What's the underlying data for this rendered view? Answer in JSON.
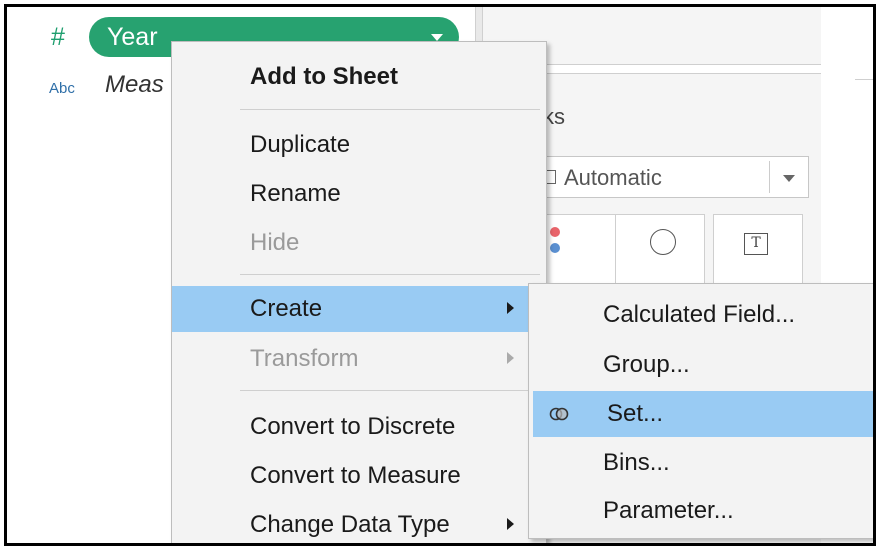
{
  "data_pane": {
    "field_type_symbol": "#",
    "pill_label": "Year",
    "abc_label": "Abc",
    "measure_label": "Meas"
  },
  "marks_panel": {
    "title": "ks",
    "mark_type": "Automatic"
  },
  "context_menu": {
    "items": [
      {
        "label": "Add to Sheet",
        "bold": true
      },
      {
        "label": "Duplicate"
      },
      {
        "label": "Rename"
      },
      {
        "label": "Hide",
        "disabled": true
      },
      {
        "label": "Create",
        "highlighted": true,
        "has_submenu": true
      },
      {
        "label": "Transform",
        "disabled": true,
        "has_submenu": true
      },
      {
        "label": "Convert to Discrete"
      },
      {
        "label": "Convert to Measure"
      },
      {
        "label": "Change Data Type",
        "has_submenu": true
      }
    ]
  },
  "create_submenu": {
    "items": [
      {
        "label": "Calculated Field..."
      },
      {
        "label": "Group..."
      },
      {
        "label": "Set...",
        "highlighted": true,
        "icon": "set-icon"
      },
      {
        "label": "Bins..."
      },
      {
        "label": "Parameter..."
      }
    ]
  },
  "colors": {
    "pill": "#27a270",
    "highlight": "#99cbf3",
    "menu_bg": "#f3f3f3",
    "disabled_text": "#9a9a9a"
  }
}
